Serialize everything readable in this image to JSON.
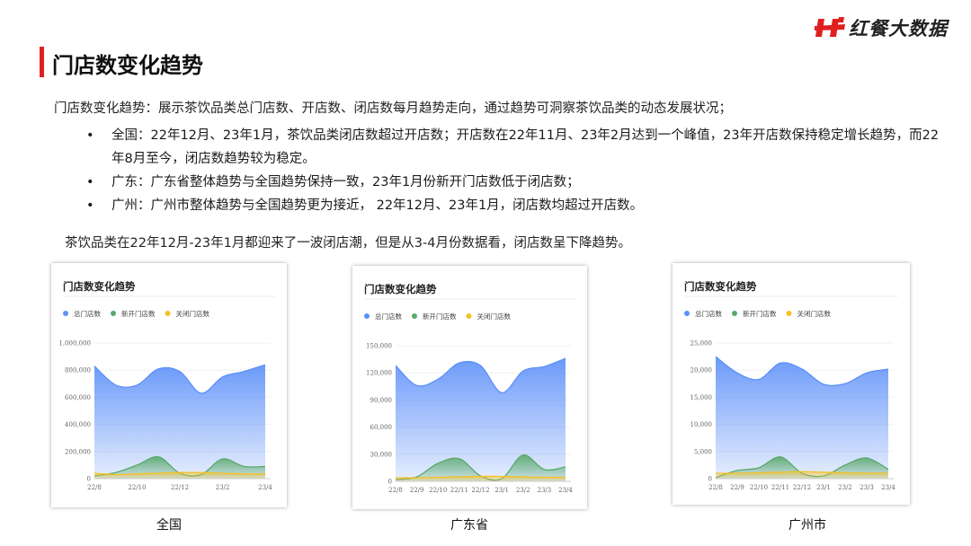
{
  "brand": {
    "name": "红餐大数据",
    "accent": "#e02020"
  },
  "page_title": "门店数变化趋势",
  "intro": "门店数变化趋势：展示茶饮品类总门店数、开店数、闭店数每月趋势走向，通过趋势可洞察茶饮品类的动态发展状况；",
  "bullets": [
    {
      "mark": "•",
      "text": "全国：22年12月、23年1月，茶饮品类闭店数超过开店数；开店数在22年11月、23年2月达到一个峰值，23年开店数保持稳定增长趋势，而22年8月至今，闭店数趋势较为稳定。"
    },
    {
      "mark": "•",
      "text": "广东：广东省整体趋势与全国趋势保持一致，23年1月份新开门店数低于闭店数；"
    },
    {
      "mark": "•",
      "text": "广州：广州市整体趋势与全国趋势更为接近， 22年12月、23年1月，闭店数均超过开店数。"
    }
  ],
  "conclusion": "茶饮品类在22年12月-23年1月都迎来了一波闭店潮，但是从3-4月份数据看，闭店数呈下降趋势。",
  "captions": [
    "全国",
    "广东省",
    "广州市"
  ],
  "chart_data": [
    {
      "type": "area",
      "title": "门店数变化趋势",
      "legend_position": "top-left",
      "x": [
        "22/8",
        "22/9",
        "22/10",
        "22/11",
        "22/12",
        "23/1",
        "23/2",
        "23/3",
        "23/4"
      ],
      "x_tick_labels": [
        "22/8",
        "22/10",
        "22/12",
        "23/2",
        "23/4"
      ],
      "ylim": [
        0,
        1000000
      ],
      "y_ticks": [
        0,
        200000,
        400000,
        600000,
        800000,
        1000000
      ],
      "y_tick_labels": [
        "0",
        "200,000",
        "400,000",
        "600,000",
        "800,000",
        "1,000,000"
      ],
      "grid": true,
      "series": [
        {
          "name": "总门店数",
          "color": "#5b8ff9",
          "values": [
            830000,
            690000,
            690000,
            810000,
            790000,
            630000,
            750000,
            790000,
            840000
          ]
        },
        {
          "name": "新开门店数",
          "color": "#5aa96a",
          "values": [
            20000,
            45000,
            100000,
            160000,
            40000,
            30000,
            145000,
            90000,
            90000
          ]
        },
        {
          "name": "关闭门店数",
          "color": "#f6c022",
          "values": [
            40000,
            30000,
            35000,
            40000,
            45000,
            45000,
            40000,
            35000,
            35000
          ]
        }
      ]
    },
    {
      "type": "area",
      "title": "门店数变化趋势",
      "legend_position": "top-left",
      "x": [
        "22/8",
        "22/9",
        "22/10",
        "22/11",
        "22/12",
        "23/1",
        "23/2",
        "23/3",
        "23/4"
      ],
      "x_tick_labels": [
        "22/8",
        "22/9",
        "22/10",
        "22/11",
        "22/12",
        "23/1",
        "23/2",
        "23/3",
        "23/4"
      ],
      "ylim": [
        0,
        150000
      ],
      "y_ticks": [
        0,
        30000,
        60000,
        90000,
        120000,
        150000
      ],
      "y_tick_labels": [
        "0",
        "30,000",
        "60,000",
        "90,000",
        "120,000",
        "150,000"
      ],
      "grid": true,
      "series": [
        {
          "name": "总门店数",
          "color": "#5b8ff9",
          "values": [
            128000,
            106000,
            113000,
            131000,
            128000,
            98000,
            122000,
            127000,
            136000
          ]
        },
        {
          "name": "新开门店数",
          "color": "#5aa96a",
          "values": [
            2000,
            5000,
            20000,
            25000,
            6000,
            3000,
            29000,
            13000,
            16000
          ]
        },
        {
          "name": "关闭门店数",
          "color": "#f6c022",
          "values": [
            4000,
            4000,
            4500,
            5000,
            5500,
            5500,
            5000,
            4500,
            4500
          ]
        }
      ]
    },
    {
      "type": "area",
      "title": "门店数变化趋势",
      "legend_position": "top-left",
      "x": [
        "22/8",
        "22/9",
        "22/10",
        "22/11",
        "22/12",
        "23/1",
        "23/2",
        "23/3",
        "23/4"
      ],
      "x_tick_labels": [
        "22/8",
        "22/9",
        "22/10",
        "22/11",
        "22/12",
        "23/1",
        "23/2",
        "23/3",
        "23/4"
      ],
      "ylim": [
        0,
        25000
      ],
      "y_ticks": [
        0,
        5000,
        10000,
        15000,
        20000,
        25000
      ],
      "y_tick_labels": [
        "0",
        "5,000",
        "10,000",
        "15,000",
        "20,000",
        "25,000"
      ],
      "grid": true,
      "series": [
        {
          "name": "总门店数",
          "color": "#5b8ff9",
          "values": [
            22500,
            19500,
            18300,
            21300,
            20200,
            17400,
            17500,
            19500,
            20200
          ]
        },
        {
          "name": "新开门店数",
          "color": "#5aa96a",
          "values": [
            200,
            1500,
            2000,
            4000,
            1000,
            500,
            2500,
            3800,
            1700
          ]
        },
        {
          "name": "关闭门店数",
          "color": "#f6c022",
          "values": [
            1000,
            1000,
            1100,
            1200,
            1300,
            1200,
            1100,
            1000,
            1000
          ]
        }
      ]
    }
  ]
}
